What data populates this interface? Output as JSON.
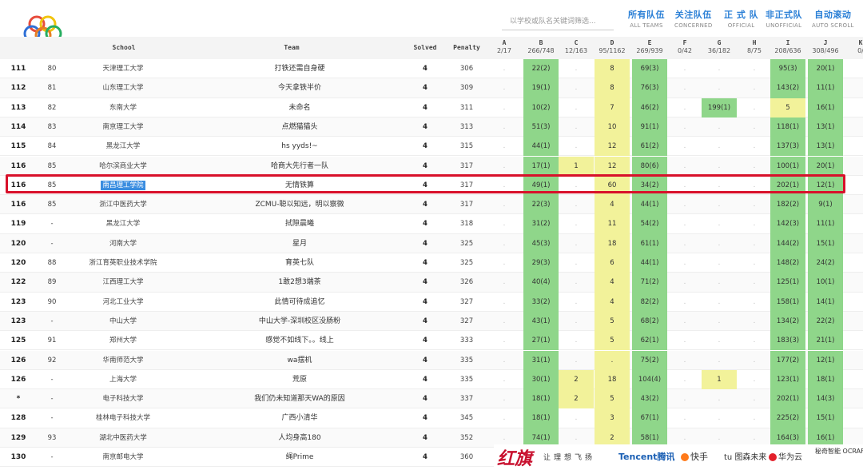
{
  "search": {
    "placeholder": "以学校或队名关键词筛选..."
  },
  "filters": [
    {
      "zh": "所有队伍",
      "en": "ALL TEAMS"
    },
    {
      "zh": "关注队伍",
      "en": "CONCERNED"
    },
    {
      "zh": "正 式 队",
      "en": "OFFICIAL"
    },
    {
      "zh": "非正式队",
      "en": "UNOFFICIAL"
    },
    {
      "zh": "自动滚动",
      "en": "AUTO SCROLL"
    }
  ],
  "header": {
    "school": "School",
    "team": "Team",
    "solved": "Solved",
    "penalty": "Penalty"
  },
  "problems": [
    {
      "letter": "A",
      "stat": "2/17"
    },
    {
      "letter": "B",
      "stat": "266/748"
    },
    {
      "letter": "C",
      "stat": "12/163"
    },
    {
      "letter": "D",
      "stat": "95/1162"
    },
    {
      "letter": "E",
      "stat": "269/939"
    },
    {
      "letter": "F",
      "stat": "0/42"
    },
    {
      "letter": "G",
      "stat": "36/182"
    },
    {
      "letter": "H",
      "stat": "8/75"
    },
    {
      "letter": "I",
      "stat": "208/636"
    },
    {
      "letter": "J",
      "stat": "308/496"
    },
    {
      "letter": "K",
      "stat": "0/"
    }
  ],
  "rows": [
    {
      "rank": "111",
      "orank": "80",
      "school": "天津理工大学",
      "team": "打铁还需自身硬",
      "solved": "4",
      "penalty": "306",
      "cells": [
        ".",
        "22(2)",
        ".",
        "8",
        "69(3)",
        ".",
        ".",
        ".",
        "95(3)",
        "20(1)"
      ],
      "types": [
        "na",
        "ac",
        "na",
        "pd",
        "ac",
        "na",
        "na",
        "na",
        "ac",
        "ac"
      ]
    },
    {
      "rank": "112",
      "orank": "81",
      "school": "山东理工大学",
      "team": "今天拿铁半价",
      "solved": "4",
      "penalty": "309",
      "cells": [
        ".",
        "19(1)",
        ".",
        "8",
        "76(3)",
        ".",
        ".",
        ".",
        "143(2)",
        "11(1)"
      ],
      "types": [
        "na",
        "ac",
        "na",
        "pd",
        "ac",
        "na",
        "na",
        "na",
        "ac",
        "ac"
      ]
    },
    {
      "rank": "113",
      "orank": "82",
      "school": "东南大学",
      "team": "未命名",
      "solved": "4",
      "penalty": "311",
      "cells": [
        ".",
        "10(2)",
        ".",
        "7",
        "46(2)",
        ".",
        "199(1)",
        ".",
        "5",
        "16(1)"
      ],
      "types": [
        "na",
        "ac",
        "na",
        "pd",
        "ac",
        "na",
        "ac",
        "na",
        "pd",
        "ac"
      ]
    },
    {
      "rank": "114",
      "orank": "83",
      "school": "南京理工大学",
      "team": "点燃猫猫头",
      "solved": "4",
      "penalty": "313",
      "cells": [
        ".",
        "51(3)",
        ".",
        "10",
        "91(1)",
        ".",
        ".",
        ".",
        "118(1)",
        "13(1)"
      ],
      "types": [
        "na",
        "ac",
        "na",
        "pd",
        "ac",
        "na",
        "na",
        "na",
        "ac",
        "ac"
      ]
    },
    {
      "rank": "115",
      "orank": "84",
      "school": "黑龙江大学",
      "team": "hs yyds!~",
      "solved": "4",
      "penalty": "315",
      "cells": [
        ".",
        "44(1)",
        ".",
        "12",
        "61(2)",
        ".",
        ".",
        ".",
        "137(3)",
        "13(1)"
      ],
      "types": [
        "na",
        "ac",
        "na",
        "pd",
        "ac",
        "na",
        "na",
        "na",
        "ac",
        "ac"
      ]
    },
    {
      "rank": "116",
      "orank": "85",
      "school": "哈尔滨商业大学",
      "team": "哈商大先行者一队",
      "solved": "4",
      "penalty": "317",
      "cells": [
        ".",
        "17(1)",
        "1",
        "12",
        "80(6)",
        ".",
        ".",
        ".",
        "100(1)",
        "20(1)"
      ],
      "types": [
        "na",
        "ac",
        "pd",
        "pd",
        "ac",
        "na",
        "na",
        "na",
        "ac",
        "ac"
      ]
    },
    {
      "rank": "116",
      "orank": "85",
      "school": "南昌理工学院",
      "team": "无情铁算",
      "solved": "4",
      "penalty": "317",
      "cells": [
        ".",
        "49(1)",
        ".",
        "60",
        "34(2)",
        ".",
        ".",
        ".",
        "202(1)",
        "12(1)"
      ],
      "types": [
        "na",
        "ac",
        "na",
        "pd",
        "ac",
        "na",
        "na",
        "na",
        "ac",
        "ac"
      ],
      "highlight": true
    },
    {
      "rank": "116",
      "orank": "85",
      "school": "浙江中医药大学",
      "team": "ZCMU-聪以知远，明以察微",
      "solved": "4",
      "penalty": "317",
      "cells": [
        ".",
        "22(3)",
        ".",
        "4",
        "44(1)",
        ".",
        ".",
        ".",
        "182(2)",
        "9(1)"
      ],
      "types": [
        "na",
        "ac",
        "na",
        "pd",
        "ac",
        "na",
        "na",
        "na",
        "ac",
        "ac"
      ]
    },
    {
      "rank": "119",
      "orank": "-",
      "school": "黑龙江大学",
      "team": "拭隙晨曦",
      "solved": "4",
      "penalty": "318",
      "cells": [
        ".",
        "31(2)",
        ".",
        "11",
        "54(2)",
        ".",
        ".",
        ".",
        "142(3)",
        "11(1)"
      ],
      "types": [
        "na",
        "ac",
        "na",
        "pd",
        "ac",
        "na",
        "na",
        "na",
        "ac",
        "ac"
      ]
    },
    {
      "rank": "120",
      "orank": "-",
      "school": "河南大学",
      "team": "星月",
      "solved": "4",
      "penalty": "325",
      "cells": [
        ".",
        "45(3)",
        ".",
        "18",
        "61(1)",
        ".",
        ".",
        ".",
        "144(2)",
        "15(1)"
      ],
      "types": [
        "na",
        "ac",
        "na",
        "pd",
        "ac",
        "na",
        "na",
        "na",
        "ac",
        "ac"
      ]
    },
    {
      "rank": "120",
      "orank": "88",
      "school": "浙江育英职业技术学院",
      "team": "育英七队",
      "solved": "4",
      "penalty": "325",
      "cells": [
        ".",
        "29(3)",
        ".",
        "6",
        "44(1)",
        ".",
        ".",
        ".",
        "148(2)",
        "24(2)"
      ],
      "types": [
        "na",
        "ac",
        "na",
        "pd",
        "ac",
        "na",
        "na",
        "na",
        "ac",
        "ac"
      ]
    },
    {
      "rank": "122",
      "orank": "89",
      "school": "江西理工大学",
      "team": "1敢2想3端茶",
      "solved": "4",
      "penalty": "326",
      "cells": [
        ".",
        "40(4)",
        ".",
        "4",
        "71(2)",
        ".",
        ".",
        ".",
        "125(1)",
        "10(1)"
      ],
      "types": [
        "na",
        "ac",
        "na",
        "pd",
        "ac",
        "na",
        "na",
        "na",
        "ac",
        "ac"
      ]
    },
    {
      "rank": "123",
      "orank": "90",
      "school": "河北工业大学",
      "team": "此情可待成追忆",
      "solved": "4",
      "penalty": "327",
      "cells": [
        ".",
        "33(2)",
        ".",
        "4",
        "82(2)",
        ".",
        ".",
        ".",
        "158(1)",
        "14(1)"
      ],
      "types": [
        "na",
        "ac",
        "na",
        "pd",
        "ac",
        "na",
        "na",
        "na",
        "ac",
        "ac"
      ]
    },
    {
      "rank": "123",
      "orank": "-",
      "school": "中山大学",
      "team": "中山大学-深圳校区没肠粉",
      "solved": "4",
      "penalty": "327",
      "cells": [
        ".",
        "43(1)",
        ".",
        "5",
        "68(2)",
        ".",
        ".",
        ".",
        "134(2)",
        "22(2)"
      ],
      "types": [
        "na",
        "ac",
        "na",
        "pd",
        "ac",
        "na",
        "na",
        "na",
        "ac",
        "ac"
      ]
    },
    {
      "rank": "125",
      "orank": "91",
      "school": "郑州大学",
      "team": "感觉不如线下。。线上",
      "solved": "4",
      "penalty": "333",
      "cells": [
        ".",
        "27(1)",
        ".",
        "5",
        "62(1)",
        ".",
        ".",
        ".",
        "183(3)",
        "21(1)"
      ],
      "types": [
        "na",
        "ac",
        "na",
        "pd",
        "ac",
        "na",
        "na",
        "na",
        "ac",
        "ac"
      ]
    },
    {
      "rank": "126",
      "orank": "92",
      "school": "华南师范大学",
      "team": "wa摆机",
      "solved": "4",
      "penalty": "335",
      "cells": [
        ".",
        "31(1)",
        ".",
        ".",
        "75(2)",
        ".",
        ".",
        ".",
        "177(2)",
        "12(1)"
      ],
      "types": [
        "na",
        "ac",
        "na",
        "pd",
        "ac",
        "na",
        "na",
        "na",
        "ac",
        "ac"
      ]
    },
    {
      "rank": "126",
      "orank": "-",
      "school": "上海大学",
      "team": "荒原",
      "solved": "4",
      "penalty": "335",
      "cells": [
        ".",
        "30(1)",
        "2",
        "18",
        "104(4)",
        ".",
        "1",
        ".",
        "123(1)",
        "18(1)"
      ],
      "types": [
        "na",
        "ac",
        "pd",
        "pd",
        "ac",
        "na",
        "pd",
        "na",
        "ac",
        "ac"
      ]
    },
    {
      "rank": "*",
      "orank": "-",
      "school": "电子科技大学",
      "team": "我们仍未知道那天WA的原因",
      "solved": "4",
      "penalty": "337",
      "cells": [
        ".",
        "18(1)",
        "2",
        "5",
        "43(2)",
        ".",
        ".",
        ".",
        "202(1)",
        "14(3)"
      ],
      "types": [
        "na",
        "ac",
        "pd",
        "pd",
        "ac",
        "na",
        "na",
        "na",
        "ac",
        "ac"
      ]
    },
    {
      "rank": "128",
      "orank": "-",
      "school": "桂林电子科技大学",
      "team": "广西小清华",
      "solved": "4",
      "penalty": "345",
      "cells": [
        ".",
        "18(1)",
        ".",
        "3",
        "67(1)",
        ".",
        ".",
        ".",
        "225(2)",
        "15(1)"
      ],
      "types": [
        "na",
        "ac",
        "na",
        "pd",
        "ac",
        "na",
        "na",
        "na",
        "ac",
        "ac"
      ]
    },
    {
      "rank": "129",
      "orank": "93",
      "school": "湖北中医药大学",
      "team": "人均身高180",
      "solved": "4",
      "penalty": "352",
      "cells": [
        ".",
        "74(1)",
        ".",
        "2",
        "58(1)",
        ".",
        ".",
        ".",
        "164(3)",
        "16(1)"
      ],
      "types": [
        "na",
        "ac",
        "na",
        "pd",
        "ac",
        "na",
        "na",
        "na",
        "ac",
        "ac"
      ]
    },
    {
      "rank": "130",
      "orank": "-",
      "school": "南京邮电大学",
      "team": "绳Prime",
      "solved": "4",
      "penalty": "360",
      "cells": [
        ".",
        "",
        ".",
        "",
        "",
        ".",
        ".",
        ".",
        "",
        ""
      ],
      "types": [
        "na",
        "ac",
        "na",
        "pd",
        "ac",
        "na",
        "na",
        "na",
        "ac",
        "ac"
      ]
    }
  ],
  "sponsors": {
    "hongqi": "红旗",
    "slogan": "让理想飞扬",
    "tencent": "Tencent腾讯",
    "kuaishou": "快手",
    "tu": "tu 图森未来",
    "huawei": "华为云",
    "ocraft": "秘奇智能 OCRAFT"
  },
  "colors": {
    "accepted": "#8fd68a",
    "pending": "#f2f29a",
    "highlight_border": "#d8102a",
    "filter_text": "#2a7fd6"
  }
}
